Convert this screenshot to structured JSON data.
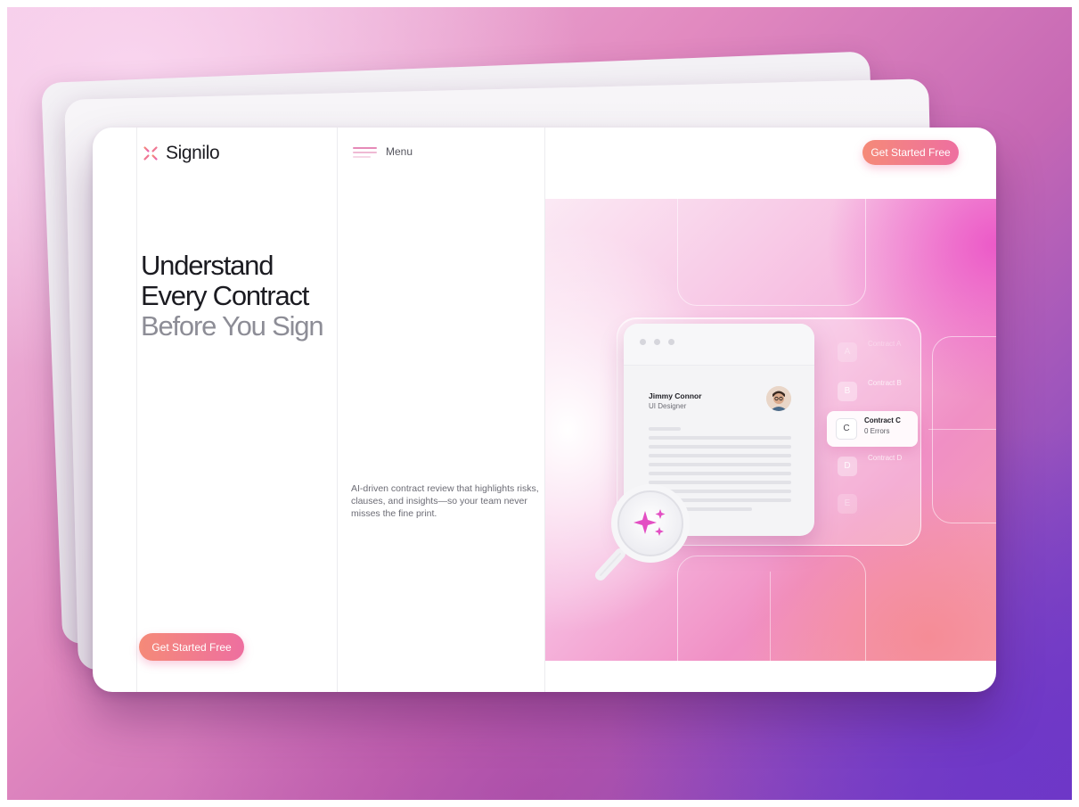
{
  "brand": {
    "name": "Signilo",
    "accent": "#ee6fa0"
  },
  "nav": {
    "menu_label": "Menu"
  },
  "header_cta": {
    "label": "Get Started Free"
  },
  "hero": {
    "headline_line1": "Understand",
    "headline_line2": "Every Contract",
    "headline_line3": "Before You Sign",
    "description": "AI-driven contract review that highlights risks, clauses, and insights—so your team never misses the fine print.",
    "cta_label": "Get Started Free"
  },
  "illustration": {
    "user_name": "Jimmy Connor",
    "user_role": "UI Designer",
    "contracts": [
      {
        "letter": "A",
        "title": "Contract A",
        "status": ""
      },
      {
        "letter": "B",
        "title": "Contract B",
        "status": ""
      },
      {
        "letter": "C",
        "title": "Contract C",
        "status": "0 Errors"
      },
      {
        "letter": "D",
        "title": "Contract D",
        "status": ""
      },
      {
        "letter": "E",
        "title": "",
        "status": ""
      }
    ],
    "icons": [
      "sparkle-icon",
      "magnifier-icon",
      "avatar-icon"
    ]
  }
}
